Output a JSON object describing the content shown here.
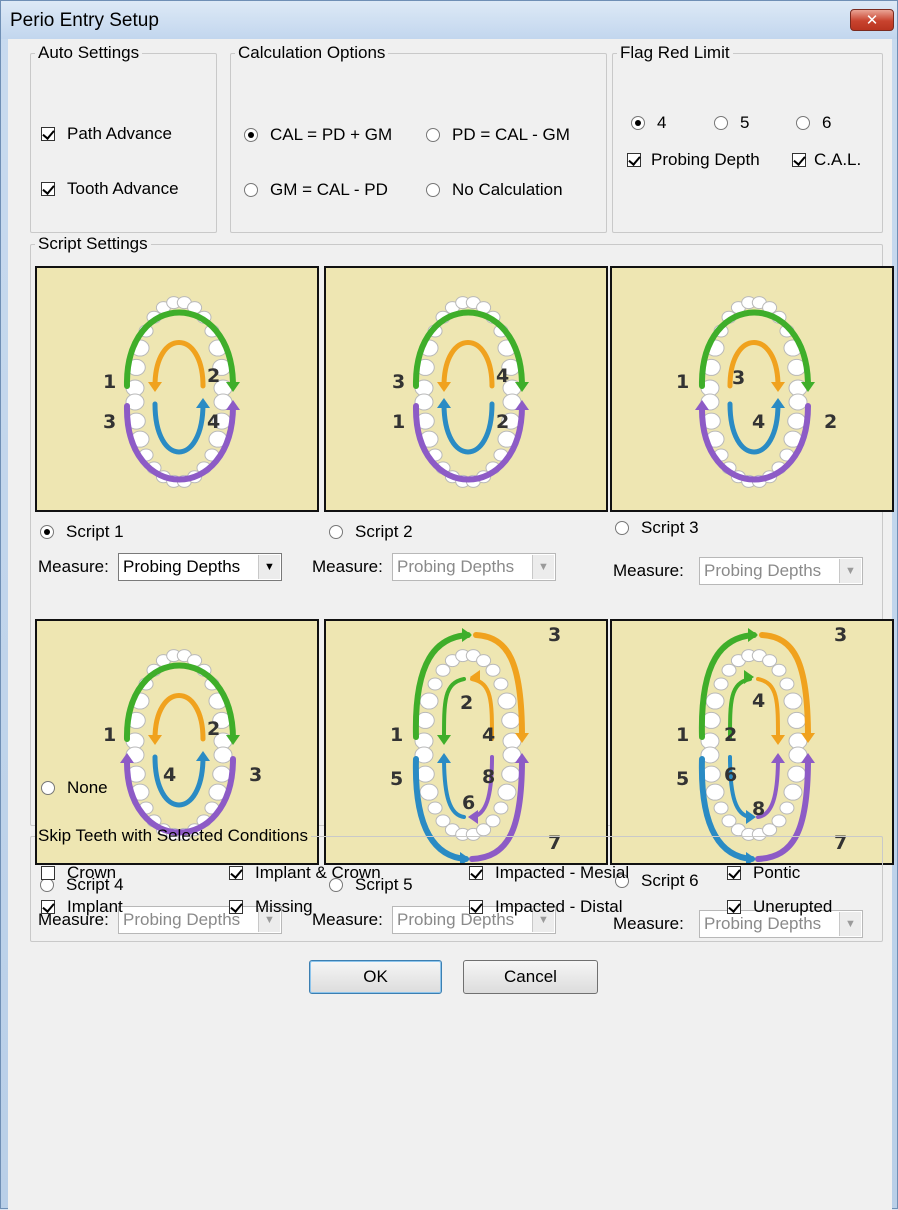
{
  "window": {
    "title": "Perio Entry Setup",
    "close_glyph": "✕"
  },
  "auto_settings": {
    "legend": "Auto Settings",
    "path_advance": {
      "label": "Path Advance",
      "checked": true
    },
    "tooth_advance": {
      "label": "Tooth Advance",
      "checked": true
    }
  },
  "calculation": {
    "legend": "Calculation Options",
    "options": [
      {
        "label": "CAL = PD + GM",
        "selected": true
      },
      {
        "label": "PD = CAL - GM",
        "selected": false
      },
      {
        "label": "GM = CAL - PD",
        "selected": false
      },
      {
        "label": "No Calculation",
        "selected": false
      }
    ]
  },
  "flag_red": {
    "legend": "Flag Red Limit",
    "limits": [
      {
        "label": "4",
        "selected": true
      },
      {
        "label": "5",
        "selected": false
      },
      {
        "label": "6",
        "selected": false
      }
    ],
    "probing_depth": {
      "label": "Probing Depth",
      "checked": true
    },
    "cal": {
      "label": "C.A.L.",
      "checked": true
    }
  },
  "scripts": {
    "legend": "Script Settings",
    "measure_label": "Measure:",
    "items": [
      {
        "label": "Script 1",
        "selected": true,
        "measure": "Probing Depths",
        "enabled": true,
        "numbers": [
          "1",
          "2",
          "3",
          "4"
        ]
      },
      {
        "label": "Script 2",
        "selected": false,
        "measure": "Probing Depths",
        "enabled": false,
        "numbers": [
          "3",
          "4",
          "1",
          "2"
        ]
      },
      {
        "label": "Script 3",
        "selected": false,
        "measure": "Probing Depths",
        "enabled": false,
        "numbers": [
          "1",
          "3",
          "4",
          "2"
        ]
      },
      {
        "label": "Script 4",
        "selected": false,
        "measure": "Probing Depths",
        "enabled": false,
        "numbers": [
          "1",
          "2",
          "4",
          "3"
        ]
      },
      {
        "label": "Script 5",
        "selected": false,
        "measure": "Probing Depths",
        "enabled": false,
        "numbers": [
          "1",
          "2",
          "3",
          "4",
          "5",
          "6",
          "7",
          "8"
        ]
      },
      {
        "label": "Script 6",
        "selected": false,
        "measure": "Probing Depths",
        "enabled": false,
        "numbers": [
          "1",
          "2",
          "3",
          "4",
          "5",
          "6",
          "7",
          "8"
        ]
      }
    ],
    "none": {
      "label": "None",
      "selected": false
    }
  },
  "skip": {
    "legend": "Skip Teeth with Selected Conditions",
    "conditions": [
      {
        "label": "Crown",
        "checked": false
      },
      {
        "label": "Implant & Crown",
        "checked": true
      },
      {
        "label": "Impacted - Mesial",
        "checked": true
      },
      {
        "label": "Pontic",
        "checked": true
      },
      {
        "label": "Implant",
        "checked": true
      },
      {
        "label": "Missing",
        "checked": true
      },
      {
        "label": "Impacted - Distal",
        "checked": true
      },
      {
        "label": "Unerupted",
        "checked": true
      }
    ]
  },
  "buttons": {
    "ok": "OK",
    "cancel": "Cancel"
  },
  "colors": {
    "green": "#3fae2a",
    "orange": "#f0a21e",
    "blue": "#2a8bc4",
    "purple": "#8d5bc6",
    "panel_bg": "#eee6b2",
    "tooth": "#ffffff"
  },
  "icons": {
    "combo_arrow": "▼"
  }
}
